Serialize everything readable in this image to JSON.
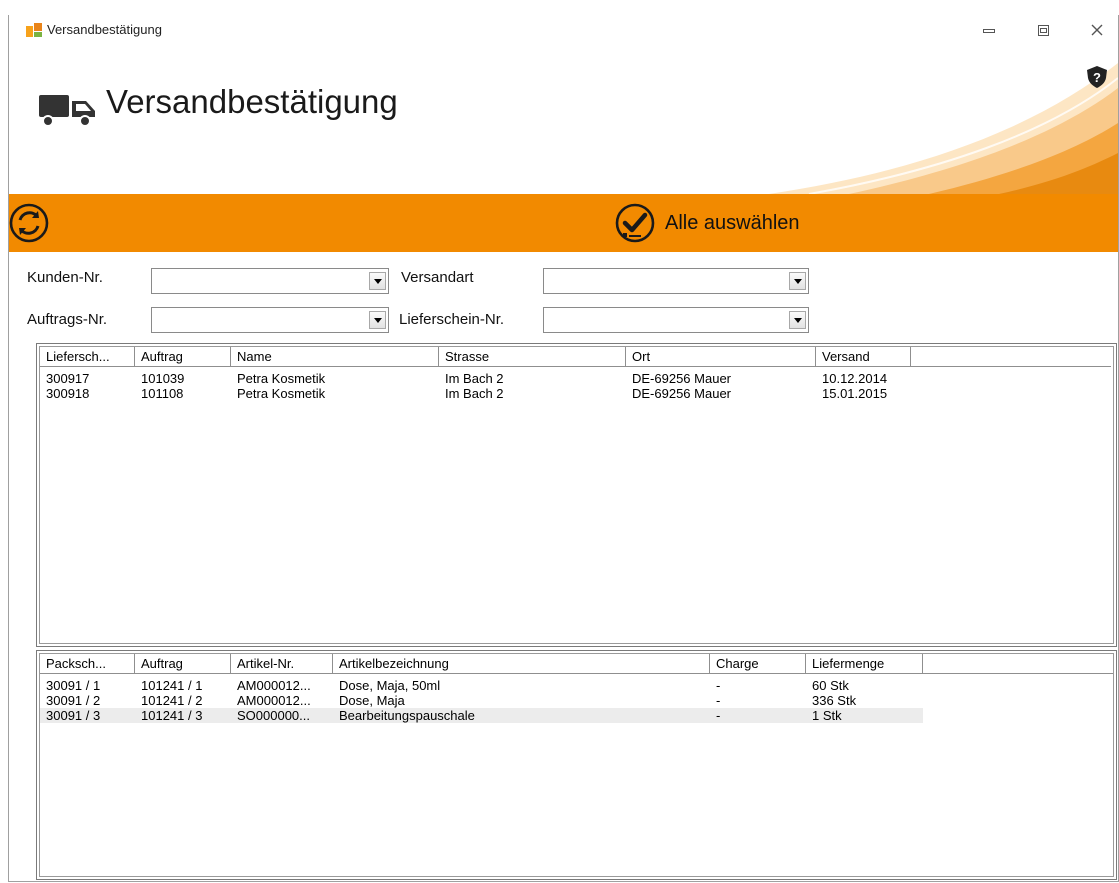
{
  "window": {
    "title": "Versandbestätigung"
  },
  "header": {
    "title": "Versandbestätigung"
  },
  "toolbar": {
    "select_all_label": "Alle auswählen"
  },
  "filters": {
    "kunden_nr": {
      "label": "Kunden-Nr.",
      "value": ""
    },
    "auftrags_nr": {
      "label": "Auftrags-Nr.",
      "value": ""
    },
    "versandart": {
      "label": "Versandart",
      "value": ""
    },
    "lieferschein_nr": {
      "label": "Lieferschein-Nr.",
      "value": ""
    }
  },
  "shipments": {
    "columns": [
      "Liefersch...",
      "Auftrag",
      "Name",
      "Strasse",
      "Ort",
      "Versand"
    ],
    "rows": [
      [
        "300917",
        "101039",
        "Petra Kosmetik",
        "Im Bach 2",
        "DE-69256 Mauer",
        "10.12.2014"
      ],
      [
        "300918",
        "101108",
        "Petra Kosmetik",
        "Im Bach 2",
        "DE-69256 Mauer",
        "15.01.2015"
      ]
    ]
  },
  "items": {
    "columns": [
      "Packsch...",
      "Auftrag",
      "Artikel-Nr.",
      "Artikelbezeichnung",
      "Charge",
      "Liefermenge"
    ],
    "rows": [
      [
        "30091 / 1",
        "101241 / 1",
        "AM000012...",
        "Dose, Maja, 50ml",
        "-",
        "60 Stk"
      ],
      [
        "30091 / 2",
        "101241 / 2",
        "AM000012...",
        "Dose, Maja",
        "-",
        "336 Stk"
      ],
      [
        "30091 / 3",
        "101241 / 3",
        "SO000000...",
        "Bearbeitungspauschale",
        "-",
        "1 Stk"
      ]
    ]
  },
  "colors": {
    "accent": "#f28a00",
    "titlebar": "#ffffff"
  }
}
